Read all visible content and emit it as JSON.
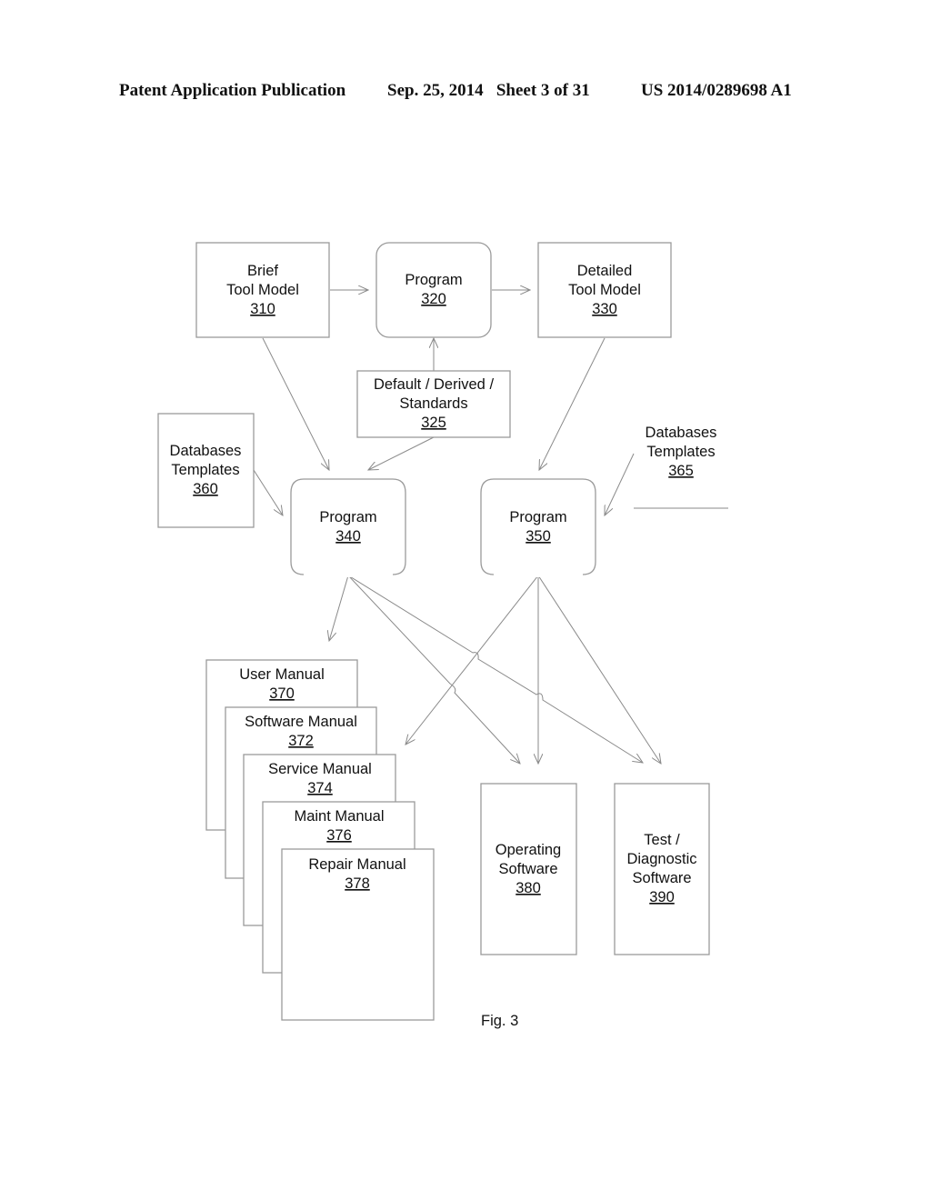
{
  "header": {
    "publication": "Patent Application Publication",
    "date_sheet": "Sep. 25, 2014   Sheet 3 of 31",
    "patent_number": "US 2014/0289698 A1"
  },
  "figure": {
    "caption": "Fig. 3",
    "nodes": {
      "brief_tool_model": {
        "lines": [
          "Brief",
          "Tool Model"
        ],
        "ref": "310"
      },
      "program_320": {
        "lines": [
          "Program"
        ],
        "ref": "320"
      },
      "detailed_tool_model": {
        "lines": [
          "Detailed",
          "Tool Model"
        ],
        "ref": "330"
      },
      "default_derived": {
        "lines": [
          "Default / Derived /",
          "Standards"
        ],
        "ref": "325"
      },
      "databases_360": {
        "lines": [
          "Databases",
          "Templates"
        ],
        "ref": "360"
      },
      "databases_365": {
        "lines": [
          "Databases",
          "Templates"
        ],
        "ref": "365"
      },
      "program_340": {
        "lines": [
          "Program"
        ],
        "ref": "340"
      },
      "program_350": {
        "lines": [
          "Program"
        ],
        "ref": "350"
      },
      "user_manual": {
        "lines": [
          "User Manual"
        ],
        "ref": "370"
      },
      "software_manual": {
        "lines": [
          "Software Manual"
        ],
        "ref": "372"
      },
      "service_manual": {
        "lines": [
          "Service Manual"
        ],
        "ref": "374"
      },
      "maint_manual": {
        "lines": [
          "Maint Manual"
        ],
        "ref": "376"
      },
      "repair_manual": {
        "lines": [
          "Repair Manual"
        ],
        "ref": "378"
      },
      "operating_software": {
        "lines": [
          "Operating",
          "Software"
        ],
        "ref": "380"
      },
      "test_diagnostic": {
        "lines": [
          "Test /",
          "Diagnostic",
          "Software"
        ],
        "ref": "390"
      }
    },
    "edges": [
      [
        "310",
        "320"
      ],
      [
        "320",
        "330"
      ],
      [
        "325",
        "320"
      ],
      [
        "310",
        "340"
      ],
      [
        "325",
        "340"
      ],
      [
        "360",
        "340"
      ],
      [
        "330",
        "350"
      ],
      [
        "365",
        "350"
      ],
      [
        "340",
        "370"
      ],
      [
        "340",
        "380"
      ],
      [
        "340",
        "390"
      ],
      [
        "350",
        "374"
      ],
      [
        "350",
        "380"
      ],
      [
        "350",
        "390"
      ]
    ]
  }
}
